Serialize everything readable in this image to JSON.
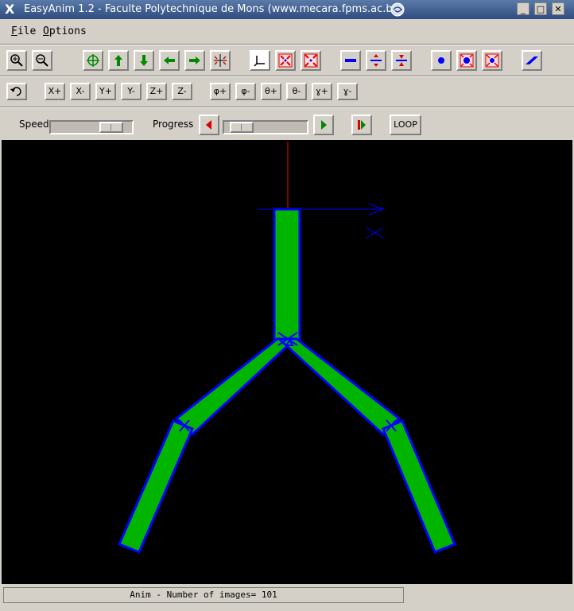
{
  "window": {
    "title": "EasyAnim 1.2 - Faculte Polytechnique de Mons (www.mecara.fpms.ac.be)"
  },
  "menu": {
    "file_first": "F",
    "file_rest": "ile",
    "options_first": "O",
    "options_rest": "ptions"
  },
  "controls": {
    "speed_label": "Speed",
    "progress_label": "Progress",
    "loop_label": "LOOP",
    "speed_fraction": 0.85,
    "progress_fraction": 0.1
  },
  "row2": {
    "x_plus": "X+",
    "x_minus": "X-",
    "y_plus": "Y+",
    "y_minus": "Y-",
    "z_plus": "Z+",
    "z_minus": "Z-",
    "phi_plus": "φ+",
    "phi_minus": "φ-",
    "theta_plus": "θ+",
    "theta_minus": "θ-",
    "psi_plus": "ɣ+",
    "psi_minus": "ɣ-"
  },
  "status": {
    "text": "Anim - Number of images= 101"
  },
  "colors": {
    "canvas": "#000000",
    "link_fill": "#00b400",
    "link_outline": "#0000ff",
    "axis_x": "#0000ff",
    "axis_y": "#ff0000"
  }
}
